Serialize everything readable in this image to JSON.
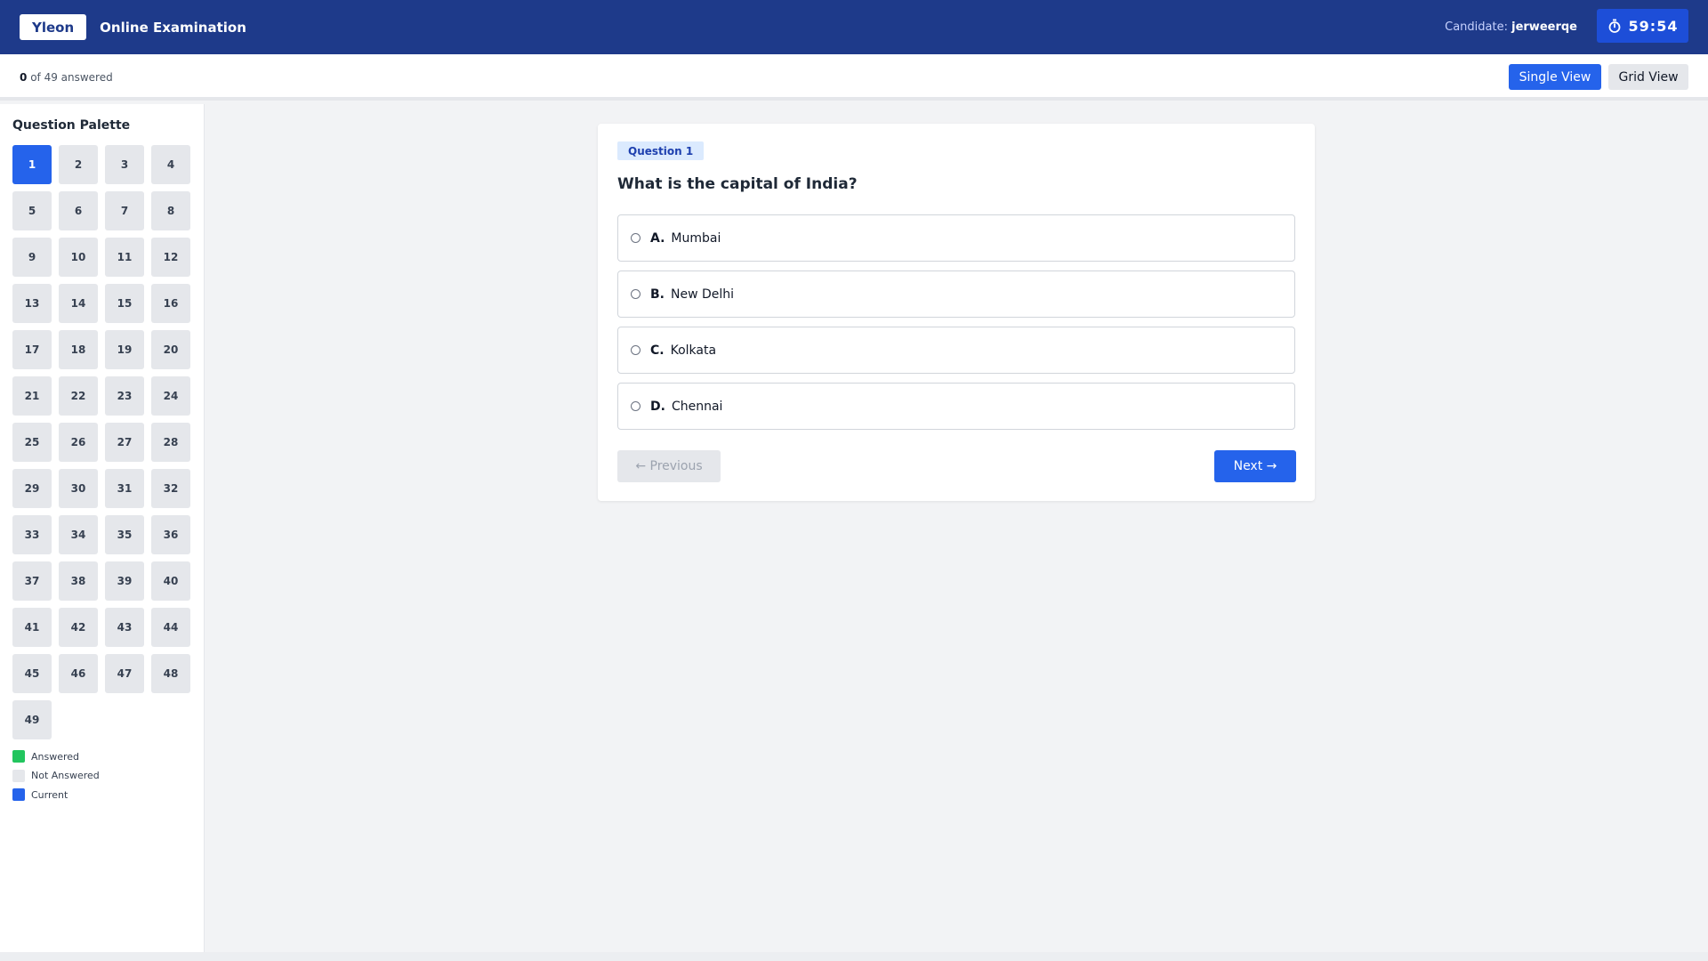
{
  "header": {
    "logo": "Yleon",
    "title": "Online Examination",
    "candidate_label": "Candidate:",
    "candidate_name": "jerweerqe",
    "timer": "59:54",
    "timer_icon": "stopwatch-icon"
  },
  "progress": {
    "answered_count": "0",
    "suffix": "of 49 answered"
  },
  "view_toggle": {
    "single_label": "Single View",
    "grid_label": "Grid View",
    "selected": "Single View"
  },
  "palette": {
    "title": "Question Palette",
    "current": 1,
    "numbers": [
      "1",
      "2",
      "3",
      "4",
      "5",
      "6",
      "7",
      "8",
      "9",
      "10",
      "11",
      "12",
      "13",
      "14",
      "15",
      "16",
      "17",
      "18",
      "19",
      "20",
      "21",
      "22",
      "23",
      "24",
      "25",
      "26",
      "27",
      "28",
      "29",
      "30",
      "31",
      "32",
      "33",
      "34",
      "35",
      "36",
      "37",
      "38",
      "39",
      "40",
      "41",
      "42",
      "43",
      "44",
      "45",
      "46",
      "47",
      "48",
      "49"
    ],
    "legend": [
      {
        "label": "Answered",
        "color": "#22c55e"
      },
      {
        "label": "Not Answered",
        "color": "#e5e7eb"
      },
      {
        "label": "Current",
        "color": "#2563eb"
      }
    ]
  },
  "question": {
    "badge": "Question 1",
    "text": "What is the capital of India?",
    "options": [
      {
        "letter": "A.",
        "text": "Mumbai"
      },
      {
        "letter": "B.",
        "text": "New Delhi"
      },
      {
        "letter": "C.",
        "text": "Kolkata"
      },
      {
        "letter": "D.",
        "text": "Chennai"
      }
    ],
    "prev_label": "← Previous",
    "next_label": "Next →"
  },
  "colors": {
    "header_bg": "#1e3a8a",
    "accent": "#2563eb",
    "answered": "#22c55e",
    "not_answered": "#e5e7eb"
  }
}
